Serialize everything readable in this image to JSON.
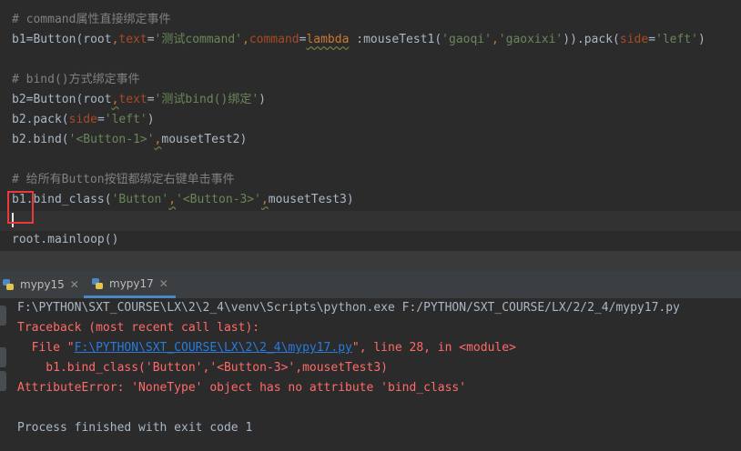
{
  "editor": {
    "lines": {
      "c1": "# command属性直接绑定事件",
      "l2a": "b1=Button(root",
      "l2b": ",",
      "l2c": "text",
      "l2d": "=",
      "l2e": "'测试command'",
      "l2f": ",",
      "l2g": "command",
      "l2h": "=",
      "l2i": "lambda",
      "l2j": " :mouseTest1(",
      "l2k": "'gaoqi'",
      "l2l": ",",
      "l2m": "'gaoxixi'",
      "l2n": ")).pack(",
      "l2o": "side",
      "l2p": "=",
      "l2q": "'left'",
      "l2r": ")",
      "c2": "# bind()方式绑定事件",
      "l5a": "b2=Button(root",
      "l5b": ",",
      "l5c": "text",
      "l5d": "=",
      "l5e": "'测试bind()绑定'",
      "l5f": ")",
      "l6a": "b2.pack(",
      "l6b": "side",
      "l6c": "=",
      "l6d": "'left'",
      "l6e": ")",
      "l7a": "b2.bind(",
      "l7b": "'<Button-1>'",
      "l7c": ",",
      "l7d": "mousetTest2)",
      "c3": "# 给所有Button按钮都绑定右键单击事件",
      "l10a": "b1.bind_class(",
      "l10b": "'Button'",
      "l10c": ",",
      "l10d": "'<Button-3>'",
      "l10e": ",",
      "l10f": "mousetTest3)",
      "l12": "root.mainloop()"
    }
  },
  "run_panel": {
    "tabs": [
      {
        "label": "mypy15",
        "close": "✕"
      },
      {
        "label": "mypy17",
        "close": "✕"
      }
    ],
    "output": {
      "cmd": "F:\\PYTHON\\SXT_COURSE\\LX\\2\\2_4\\venv\\Scripts\\python.exe F:/PYTHON/SXT_COURSE/LX/2/2_4/mypy17.py",
      "tb_head": "Traceback (most recent call last):",
      "file_pre": "  File \"",
      "file_link": "F:\\PYTHON\\SXT_COURSE\\LX\\2\\2_4\\mypy17.py",
      "file_post": "\", line 28, in <module>",
      "code": "    b1.bind_class('Button','<Button-3>',mousetTest3)",
      "error": "AttributeError: 'NoneType' object has no attribute 'bind_class'",
      "exit": "Process finished with exit code 1"
    }
  },
  "colors": {
    "comment": "#808080",
    "string": "#6a8759",
    "keyword": "#cc7832",
    "error": "#ff6b68",
    "link": "#287bde"
  }
}
